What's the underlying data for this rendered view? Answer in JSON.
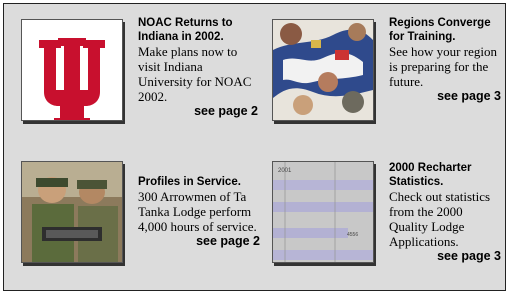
{
  "stories": [
    {
      "headline": "NOAC Returns to Indiana in 2002.",
      "body": "Make plans now to visit Indiana University for NOAC 2002.",
      "see_page": "see page 2",
      "image": "indiana-university-logo"
    },
    {
      "headline": "Regions Converge for Training.",
      "body": "See how your region is preparing for the future.",
      "see_page": "see page 3",
      "image": "regions-map-collage"
    },
    {
      "headline": "Profiles in Service.",
      "body": "300 Arrowmen of Ta Tanka Lodge perform 4,000 hours of service.",
      "see_page": "see page 2",
      "image": "arrowmen-service-photo"
    },
    {
      "headline": "2000 Recharter Statistics.",
      "body": "Check out statistics from the 2000 Quality Lodge Applications.",
      "see_page": "see page 3",
      "image": "statistics-bar-chart",
      "image_labels": [
        "2001",
        "4556"
      ]
    }
  ],
  "colors": {
    "panel": "#dcdcdc",
    "iu_crimson": "#c8102e"
  }
}
